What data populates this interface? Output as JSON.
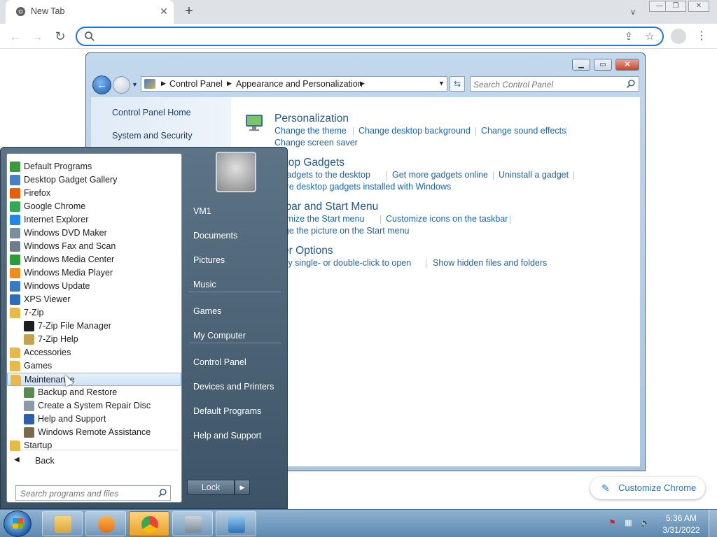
{
  "chrome": {
    "tab_title": "New Tab",
    "omnibox_placeholder": "",
    "customize_label": "Customize Chrome",
    "accent": "#1a73e8"
  },
  "control_panel": {
    "breadcrumb": [
      "Control Panel",
      "Appearance and Personalization"
    ],
    "search_placeholder": "Search Control Panel",
    "sidebar": [
      "Control Panel Home",
      "System and Security"
    ],
    "categories": [
      {
        "title": "Personalization",
        "links": [
          "Change the theme",
          "Change desktop background",
          "Change sound effects",
          "Change screen saver"
        ]
      },
      {
        "title": "sktop Gadgets",
        "links": [
          "d gadgets to the desktop",
          "Get more gadgets online",
          "Uninstall a gadget",
          "store desktop gadgets installed with Windows"
        ]
      },
      {
        "title": "skbar and Start Menu",
        "links": [
          "stomize the Start menu",
          "Customize icons on the taskbar",
          "ange the picture on the Start menu"
        ]
      },
      {
        "title": "lder Options",
        "links": [
          "ecify single- or double-click to open",
          "Show hidden files and folders"
        ]
      }
    ]
  },
  "start_menu": {
    "programs": [
      {
        "label": "Default Programs",
        "icon": "default-programs-icon",
        "color": "#3b9a3b"
      },
      {
        "label": "Desktop Gadget Gallery",
        "icon": "gadget-gallery-icon",
        "color": "#4a7fc1"
      },
      {
        "label": "Firefox",
        "icon": "firefox-icon",
        "color": "#e66000"
      },
      {
        "label": "Google Chrome",
        "icon": "chrome-icon",
        "color": "#34a853"
      },
      {
        "label": "Internet Explorer",
        "icon": "ie-icon",
        "color": "#1e88e5"
      },
      {
        "label": "Windows DVD Maker",
        "icon": "dvd-maker-icon",
        "color": "#7a8ea3"
      },
      {
        "label": "Windows Fax and Scan",
        "icon": "fax-icon",
        "color": "#6d7d8c"
      },
      {
        "label": "Windows Media Center",
        "icon": "media-center-icon",
        "color": "#2e9b3a"
      },
      {
        "label": "Windows Media Player",
        "icon": "media-player-icon",
        "color": "#f08c1a"
      },
      {
        "label": "Windows Update",
        "icon": "windows-update-icon",
        "color": "#3a78c3"
      },
      {
        "label": "XPS Viewer",
        "icon": "xps-viewer-icon",
        "color": "#2d6cc0"
      },
      {
        "label": "7-Zip",
        "icon": "folder-icon",
        "color": "#e8b94a"
      },
      {
        "label": "7-Zip File Manager",
        "icon": "7zip-icon",
        "color": "#1e1e1e",
        "indent": true
      },
      {
        "label": "7-Zip Help",
        "icon": "help-doc-icon",
        "color": "#c7a24e",
        "indent": true
      },
      {
        "label": "Accessories",
        "icon": "folder-icon",
        "color": "#e8b94a"
      },
      {
        "label": "Games",
        "icon": "folder-icon",
        "color": "#e8b94a"
      },
      {
        "label": "Maintenance",
        "icon": "folder-icon",
        "color": "#e8b94a",
        "hover": true
      },
      {
        "label": "Backup and Restore",
        "icon": "backup-icon",
        "color": "#5a8a4f",
        "indent": true
      },
      {
        "label": "Create a System Repair Disc",
        "icon": "repair-disc-icon",
        "color": "#8a9aa8",
        "indent": true
      },
      {
        "label": "Help and Support",
        "icon": "help-icon",
        "color": "#2d5fa8",
        "indent": true
      },
      {
        "label": "Windows Remote Assistance",
        "icon": "remote-assist-icon",
        "color": "#7a6a4a",
        "indent": true
      },
      {
        "label": "Startup",
        "icon": "folder-icon",
        "color": "#e8b94a"
      }
    ],
    "back_label": "Back",
    "search_placeholder": "Search programs and files",
    "right_items": [
      "VM1",
      "Documents",
      "Pictures",
      "Music",
      "Games",
      "My Computer",
      "Control Panel",
      "Devices and Printers",
      "Default Programs",
      "Help and Support"
    ],
    "lock_label": "Lock"
  },
  "taskbar": {
    "time": "5:36 AM",
    "date": "3/31/2022",
    "buttons": [
      "explorer",
      "media-player",
      "chrome",
      "security",
      "control-panel"
    ]
  }
}
